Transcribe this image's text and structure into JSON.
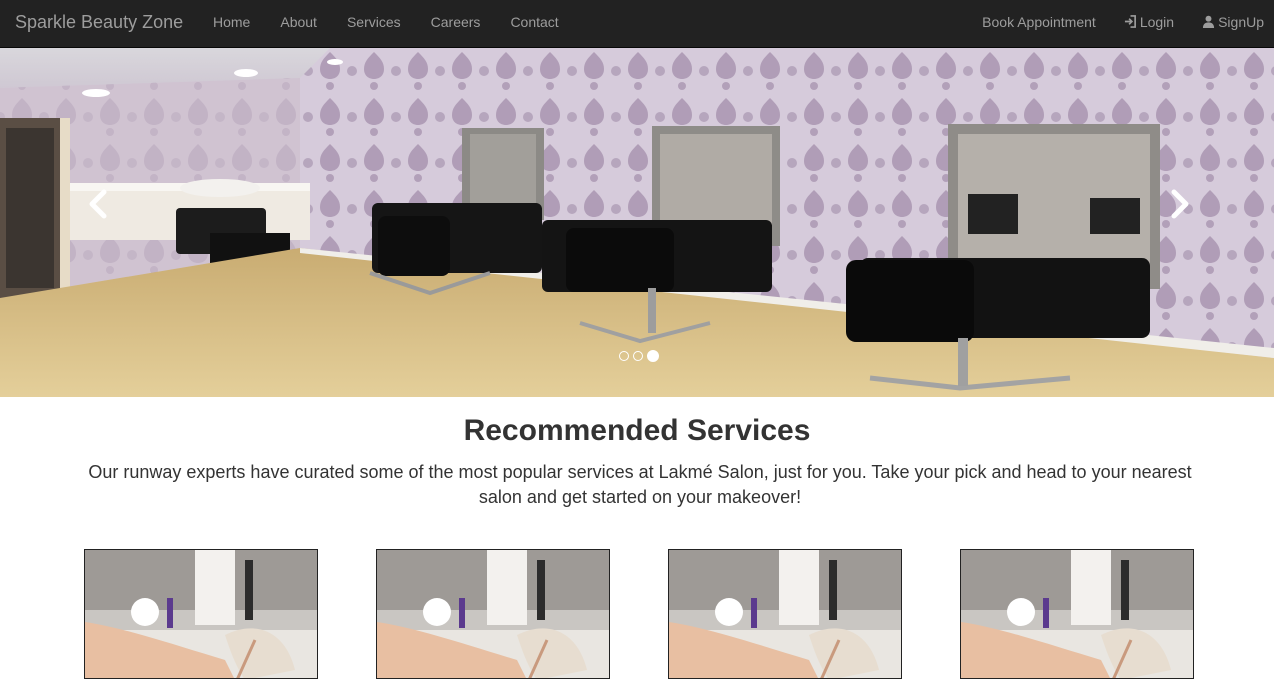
{
  "navbar": {
    "brand": "Sparkle Beauty Zone",
    "links": [
      {
        "label": "Home"
      },
      {
        "label": "About"
      },
      {
        "label": "Services"
      },
      {
        "label": "Careers"
      },
      {
        "label": "Contact"
      }
    ],
    "right_links": [
      {
        "label": "Book Appointment",
        "icon": ""
      },
      {
        "label": "Login",
        "icon": "login-icon"
      },
      {
        "label": "SignUp",
        "icon": "user-icon"
      }
    ]
  },
  "carousel": {
    "slide_count": 3,
    "active_slide": 3,
    "prev_icon": "chevron-left-icon",
    "next_icon": "chevron-right-icon"
  },
  "recommended": {
    "title": "Recommended Services",
    "description": "Our runway experts have curated some of the most popular services at Lakmé Salon, just for you. Take your pick and head to your nearest salon and get started on your makeover!"
  },
  "colors": {
    "navbar_bg": "#222222",
    "nav_text": "#9d9d9d",
    "wallpaper": "#c9bcd0",
    "floor": "#d8bf88"
  }
}
